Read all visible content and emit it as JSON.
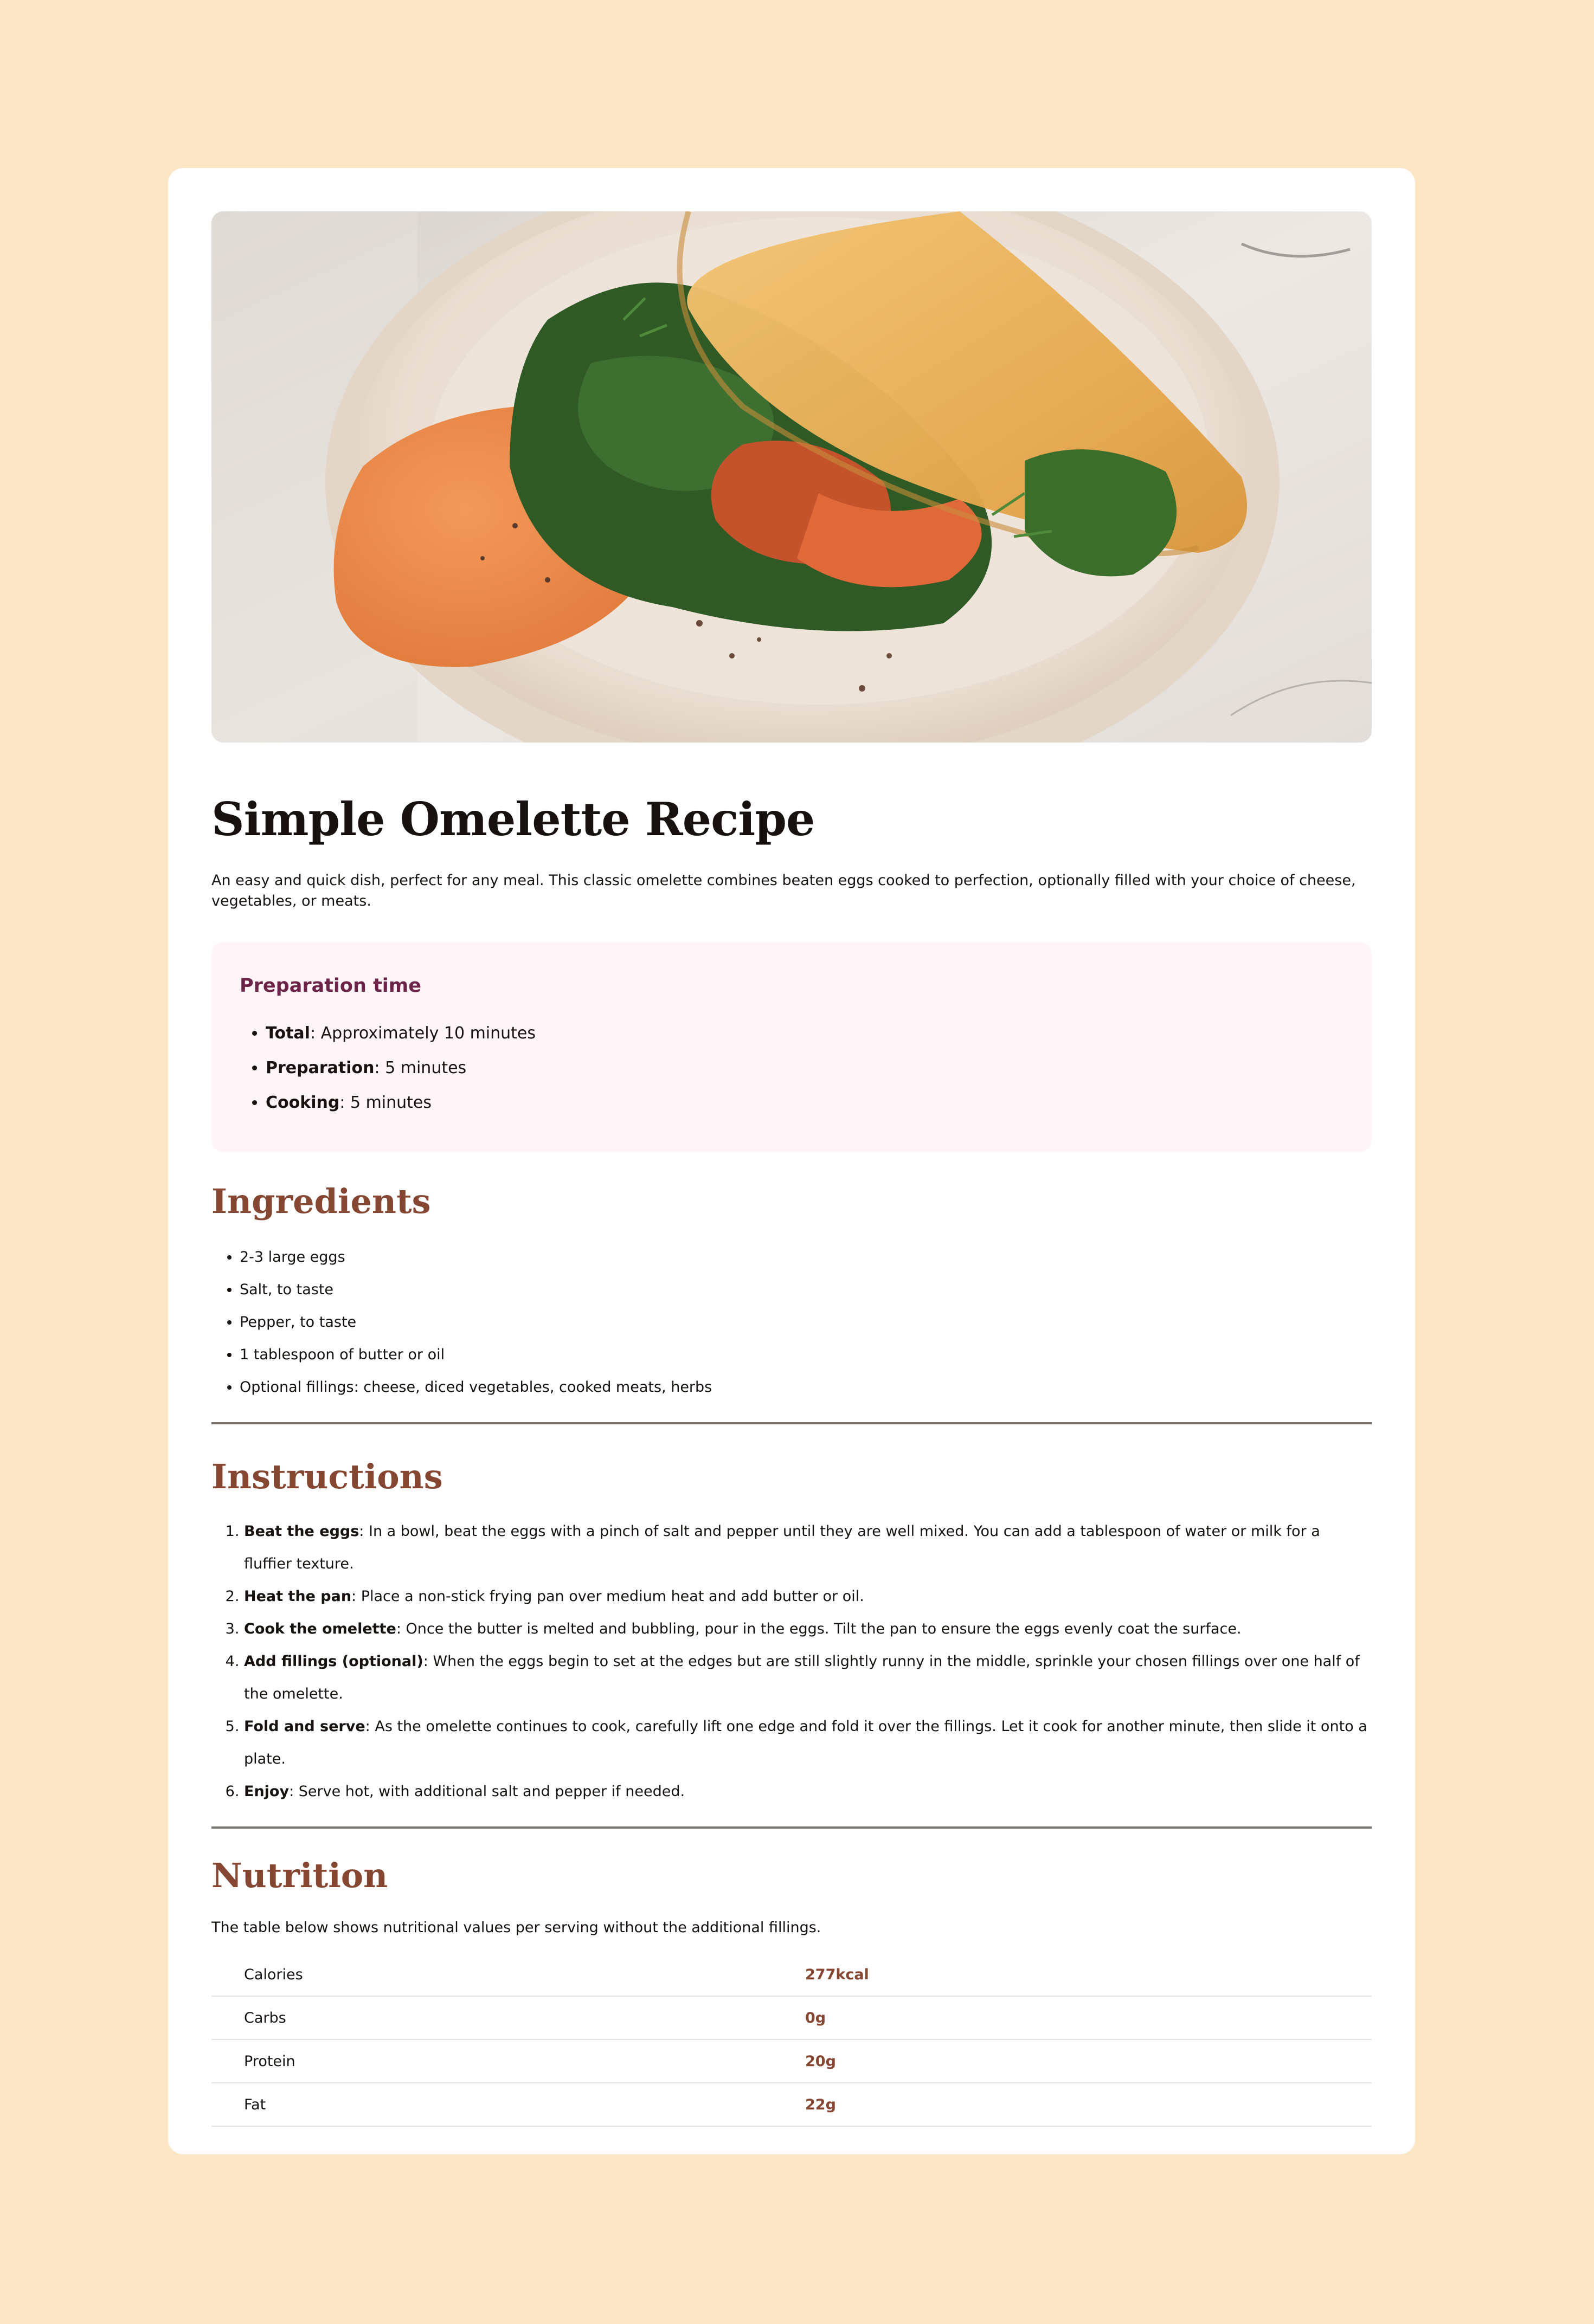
{
  "title": "Simple Omelette Recipe",
  "intro": "An easy and quick dish, perfect for any meal. This classic omelette combines beaten eggs cooked to perfection, optionally filled with your choice of cheese, vegetables, or meats.",
  "preparation": {
    "heading": "Preparation time",
    "items": [
      {
        "label": "Total",
        "text": ": Approximately 10 minutes"
      },
      {
        "label": "Preparation",
        "text": ": 5 minutes"
      },
      {
        "label": "Cooking",
        "text": ": 5 minutes"
      }
    ]
  },
  "ingredients": {
    "heading": "Ingredients",
    "items": [
      "2-3 large eggs",
      "Salt, to taste",
      "Pepper, to taste",
      "1 tablespoon of butter or oil",
      "Optional fillings: cheese, diced vegetables, cooked meats, herbs"
    ]
  },
  "instructions": {
    "heading": "Instructions",
    "items": [
      {
        "label": "Beat the eggs",
        "text": ": In a bowl, beat the eggs with a pinch of salt and pepper until they are well mixed. You can add a tablespoon of water or milk for a fluffier texture."
      },
      {
        "label": "Heat the pan",
        "text": ": Place a non-stick frying pan over medium heat and add butter or oil."
      },
      {
        "label": "Cook the omelette",
        "text": ": Once the butter is melted and bubbling, pour in the eggs. Tilt the pan to ensure the eggs evenly coat the surface."
      },
      {
        "label": "Add fillings (optional)",
        "text": ": When the eggs begin to set at the edges but are still slightly runny in the middle, sprinkle your chosen fillings over one half of the omelette."
      },
      {
        "label": "Fold and serve",
        "text": ": As the omelette continues to cook, carefully lift one edge and fold it over the fillings. Let it cook for another minute, then slide it onto a plate."
      },
      {
        "label": "Enjoy",
        "text": ": Serve hot, with additional salt and pepper if needed."
      }
    ]
  },
  "nutrition": {
    "heading": "Nutrition",
    "description": "The table below shows nutritional values per serving without the additional fillings.",
    "rows": [
      {
        "name": "Calories",
        "value": "277kcal"
      },
      {
        "name": "Carbs",
        "value": "0g"
      },
      {
        "name": "Protein",
        "value": "20g"
      },
      {
        "name": "Fat",
        "value": "22g"
      }
    ]
  },
  "colors": {
    "page_background": "#FDE6C5",
    "card_background": "#FFFFFF",
    "section_heading": "#854632",
    "prep_heading": "#6B2448",
    "prep_background": "#FFF5F8"
  }
}
